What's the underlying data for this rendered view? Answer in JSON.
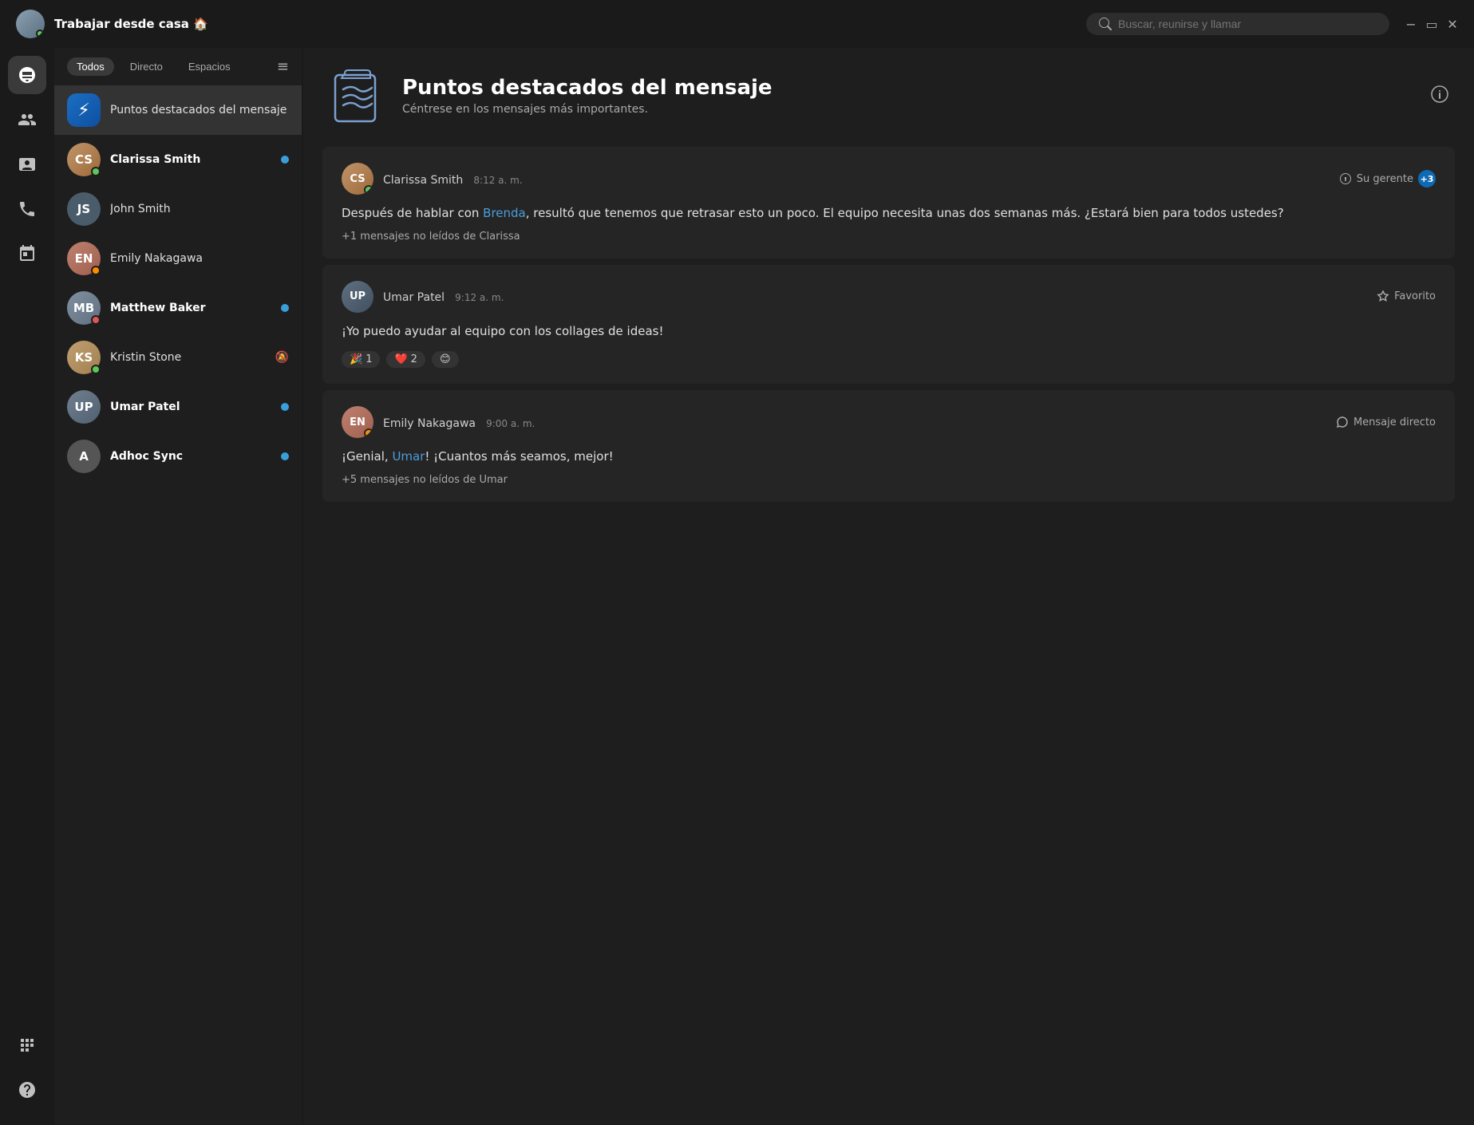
{
  "titleBar": {
    "userName": "Trabajar desde casa 🏠",
    "searchPlaceholder": "Buscar, reunirse y llamar"
  },
  "sidebar": {
    "icons": [
      {
        "name": "chat-icon",
        "label": "Chat",
        "active": true
      },
      {
        "name": "people-icon",
        "label": "Personas",
        "active": false
      },
      {
        "name": "contacts-icon",
        "label": "Contactos",
        "active": false
      },
      {
        "name": "calls-icon",
        "label": "Llamadas",
        "active": false
      },
      {
        "name": "calendar-icon",
        "label": "Calendario",
        "active": false
      }
    ]
  },
  "chatList": {
    "filters": [
      {
        "label": "Todos",
        "active": true
      },
      {
        "label": "Directo",
        "active": false
      },
      {
        "label": "Espacios",
        "active": false
      }
    ],
    "items": [
      {
        "id": "highlights",
        "name": "Puntos destacados del mensaje",
        "type": "lightning",
        "initials": "⚡",
        "status": null,
        "bold": false,
        "hasUnread": false,
        "selected": true
      },
      {
        "id": "clarissa",
        "name": "Clarissa Smith",
        "type": "avatar",
        "colorClass": "avatar-clarissa",
        "initials": "CS",
        "status": "green",
        "bold": true,
        "hasUnread": true,
        "selected": false
      },
      {
        "id": "john",
        "name": "John Smith",
        "type": "initials",
        "colorClass": "avatar-john",
        "initials": "JS",
        "status": null,
        "bold": false,
        "hasUnread": false,
        "selected": false
      },
      {
        "id": "emily",
        "name": "Emily Nakagawa",
        "type": "avatar",
        "colorClass": "avatar-emily",
        "initials": "EN",
        "status": "orange",
        "bold": false,
        "hasUnread": false,
        "selected": false
      },
      {
        "id": "matthew",
        "name": "Matthew Baker",
        "type": "avatar",
        "colorClass": "avatar-matthew",
        "initials": "MB",
        "status": "red",
        "bold": true,
        "hasUnread": true,
        "selected": false
      },
      {
        "id": "kristin",
        "name": "Kristin Stone",
        "type": "avatar",
        "colorClass": "avatar-kristin",
        "initials": "KS",
        "status": "green",
        "bold": false,
        "hasUnread": false,
        "muted": true,
        "selected": false
      },
      {
        "id": "umar",
        "name": "Umar Patel",
        "type": "avatar",
        "colorClass": "avatar-umar",
        "initials": "UP",
        "status": null,
        "bold": true,
        "hasUnread": true,
        "selected": false
      },
      {
        "id": "adhoc",
        "name": "Adhoc Sync",
        "type": "initials",
        "colorClass": "avatar-adhoc",
        "initials": "A",
        "status": null,
        "bold": true,
        "hasUnread": true,
        "selected": false
      }
    ]
  },
  "mainContent": {
    "header": {
      "title": "Puntos destacados del mensaje",
      "subtitle": "Céntrese en los mensajes más importantes."
    },
    "messages": [
      {
        "id": "msg1",
        "sender": "Clarissa Smith",
        "time": "8:12 a. m.",
        "tag": "Su gerente",
        "tagCount": "+3",
        "avatarClass": "avatar-clarissa",
        "avatarInitials": "CS",
        "statusClass": "status-green",
        "body": "Después de hablar con Brenda, resultó que tenemos que retrasar esto un poco. El equipo necesita unas dos semanas más. ¿Estará bien para todos ustedes?",
        "mention": "Brenda",
        "unreadNote": "+1 mensajes no leídos de Clarissa",
        "reactions": [],
        "actionType": "manager"
      },
      {
        "id": "msg2",
        "sender": "Umar Patel",
        "time": "9:12 a. m.",
        "tag": "Favorito",
        "avatarClass": "avatar-umar-msg",
        "avatarInitials": "UP",
        "statusClass": null,
        "body": "¡Yo puedo ayudar al equipo con los collages de ideas!",
        "mention": null,
        "unreadNote": null,
        "reactions": [
          {
            "emoji": "🎉",
            "count": "1"
          },
          {
            "emoji": "❤️",
            "count": "2"
          },
          {
            "emoji": "😊",
            "count": ""
          }
        ],
        "actionType": "favorite"
      },
      {
        "id": "msg3",
        "sender": "Emily Nakagawa",
        "time": "9:00 a. m.",
        "tag": "Mensaje directo",
        "avatarClass": "avatar-emily-msg",
        "avatarInitials": "EN",
        "statusClass": "status-orange",
        "bodyStart": "¡Genial, ",
        "mention": "Umar",
        "bodyEnd": "! ¡Cuantos más seamos, mejor!",
        "unreadNote": "+5 mensajes no leídos de Umar",
        "reactions": [],
        "actionType": "direct"
      }
    ]
  }
}
